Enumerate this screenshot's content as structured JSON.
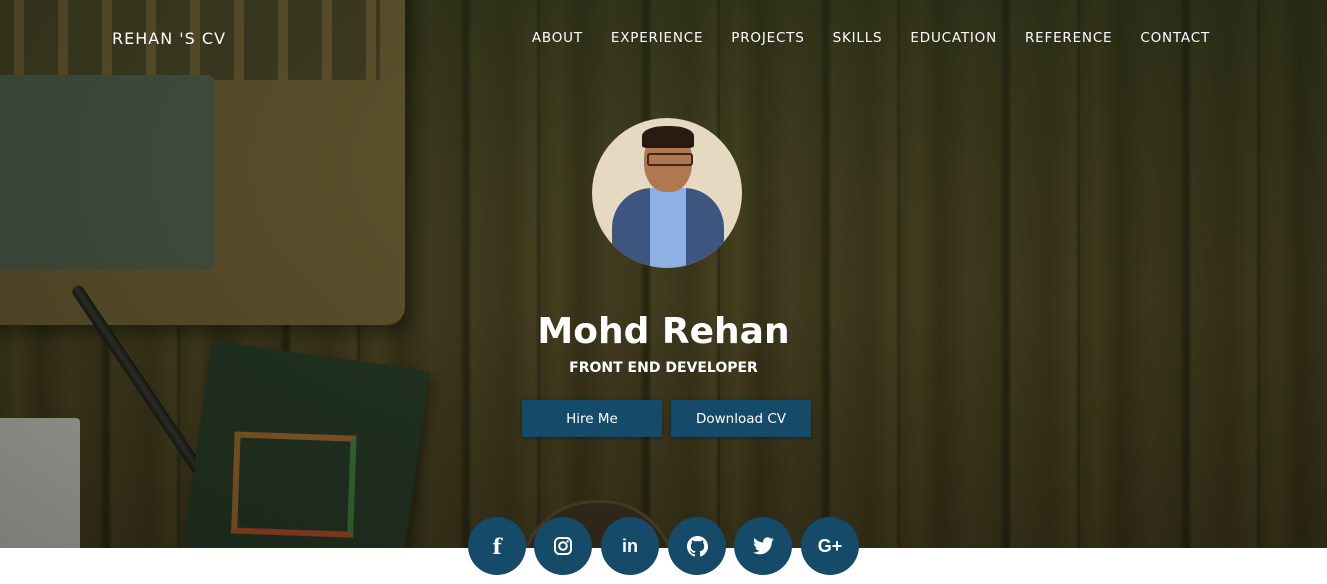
{
  "nav": {
    "brand": "REHAN 'S CV",
    "items": [
      {
        "label": "ABOUT"
      },
      {
        "label": "EXPERIENCE"
      },
      {
        "label": "PROJECTS"
      },
      {
        "label": "SKILLS"
      },
      {
        "label": "EDUCATION"
      },
      {
        "label": "REFERENCE"
      },
      {
        "label": "CONTACT"
      }
    ]
  },
  "hero": {
    "name": "Mohd Rehan",
    "role": "FRONT END DEVELOPER",
    "buttons": {
      "hire": "Hire Me",
      "download": "Download CV"
    }
  },
  "social": [
    {
      "icon": "facebook-icon",
      "glyph": "f"
    },
    {
      "icon": "instagram-icon",
      "glyph": ""
    },
    {
      "icon": "linkedin-icon",
      "glyph": "in"
    },
    {
      "icon": "github-icon",
      "glyph": ""
    },
    {
      "icon": "twitter-icon",
      "glyph": ""
    },
    {
      "icon": "google-plus-icon",
      "glyph": "G+"
    }
  ],
  "colors": {
    "accent": "#154a68",
    "text": "#ffffff"
  }
}
